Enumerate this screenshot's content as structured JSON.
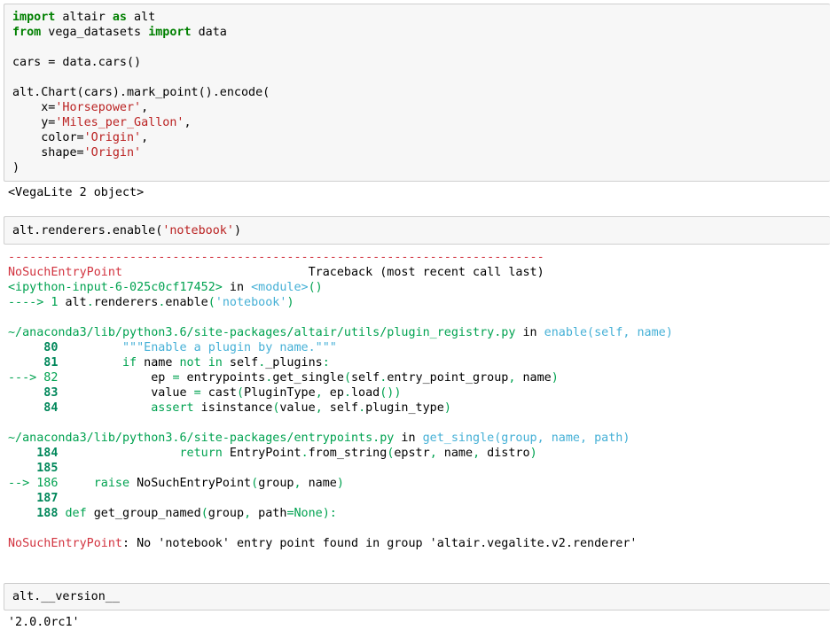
{
  "cell1": {
    "lines": [
      {
        "parts": [
          {
            "t": "import",
            "c": "kw"
          },
          {
            "t": " altair "
          },
          {
            "t": "as",
            "c": "kw"
          },
          {
            "t": " alt"
          }
        ]
      },
      {
        "parts": [
          {
            "t": "from",
            "c": "kw"
          },
          {
            "t": " vega_datasets "
          },
          {
            "t": "import",
            "c": "kw"
          },
          {
            "t": " data"
          }
        ]
      },
      {
        "parts": [
          {
            "t": ""
          }
        ]
      },
      {
        "parts": [
          {
            "t": "cars = data.cars()"
          }
        ]
      },
      {
        "parts": [
          {
            "t": ""
          }
        ]
      },
      {
        "parts": [
          {
            "t": "alt.Chart(cars).mark_point().encode("
          }
        ]
      },
      {
        "parts": [
          {
            "t": "    x="
          },
          {
            "t": "'Horsepower'",
            "c": "str"
          },
          {
            "t": ","
          }
        ]
      },
      {
        "parts": [
          {
            "t": "    y="
          },
          {
            "t": "'Miles_per_Gallon'",
            "c": "str"
          },
          {
            "t": ","
          }
        ]
      },
      {
        "parts": [
          {
            "t": "    color="
          },
          {
            "t": "'Origin'",
            "c": "str"
          },
          {
            "t": ","
          }
        ]
      },
      {
        "parts": [
          {
            "t": "    shape="
          },
          {
            "t": "'Origin'",
            "c": "str"
          }
        ]
      },
      {
        "parts": [
          {
            "t": ")"
          }
        ]
      }
    ]
  },
  "output1": {
    "text": "<VegaLite 2 object>"
  },
  "cell2": {
    "lines": [
      {
        "parts": [
          {
            "t": "alt.renderers.enable("
          },
          {
            "t": "'notebook'",
            "c": "str"
          },
          {
            "t": ")"
          }
        ]
      }
    ]
  },
  "traceback": {
    "lines": [
      {
        "parts": [
          {
            "t": "---------------------------------------------------------------------------",
            "c": "dashes"
          }
        ]
      },
      {
        "parts": [
          {
            "t": "NoSuchEntryPoint",
            "c": "red"
          },
          {
            "t": "                          Traceback (most recent call last)"
          }
        ]
      },
      {
        "parts": [
          {
            "t": "<ipython-input-6-025c0cf17452>",
            "c": "green"
          },
          {
            "t": " in "
          },
          {
            "t": "<module>",
            "c": "cyan"
          },
          {
            "t": "()",
            "c": "green"
          }
        ]
      },
      {
        "parts": [
          {
            "t": "---->",
            "c": "green"
          },
          {
            "t": " 1",
            "c": "green"
          },
          {
            "t": " alt"
          },
          {
            "t": ".",
            "c": "green"
          },
          {
            "t": "renderers"
          },
          {
            "t": ".",
            "c": "green"
          },
          {
            "t": "enable"
          },
          {
            "t": "(",
            "c": "green"
          },
          {
            "t": "'notebook'",
            "c": "cyan"
          },
          {
            "t": ")",
            "c": "green"
          }
        ]
      },
      {
        "parts": [
          {
            "t": ""
          }
        ]
      },
      {
        "parts": [
          {
            "t": "~/anaconda3/lib/python3.6/site-packages/altair/utils/plugin_registry.py",
            "c": "green"
          },
          {
            "t": " in "
          },
          {
            "t": "enable",
            "c": "cyan"
          },
          {
            "t": "(self, name)",
            "c": "cyan"
          }
        ]
      },
      {
        "parts": [
          {
            "t": "     80",
            "c": "ln"
          },
          {
            "t": "         "
          },
          {
            "t": "\"\"\"Enable a plugin by name.\"\"\"",
            "c": "cyan"
          }
        ]
      },
      {
        "parts": [
          {
            "t": "     81",
            "c": "ln"
          },
          {
            "t": "         "
          },
          {
            "t": "if",
            "c": "green"
          },
          {
            "t": " name "
          },
          {
            "t": "not",
            "c": "green"
          },
          {
            "t": " "
          },
          {
            "t": "in",
            "c": "green"
          },
          {
            "t": " self"
          },
          {
            "t": ".",
            "c": "green"
          },
          {
            "t": "_plugins"
          },
          {
            "t": ":",
            "c": "green"
          }
        ]
      },
      {
        "parts": [
          {
            "t": "---> 82",
            "c": "ln-arrow"
          },
          {
            "t": "             ep "
          },
          {
            "t": "=",
            "c": "green"
          },
          {
            "t": " entrypoints"
          },
          {
            "t": ".",
            "c": "green"
          },
          {
            "t": "get_single"
          },
          {
            "t": "(",
            "c": "green"
          },
          {
            "t": "self"
          },
          {
            "t": ".",
            "c": "green"
          },
          {
            "t": "entry_point_group"
          },
          {
            "t": ",",
            "c": "green"
          },
          {
            "t": " name"
          },
          {
            "t": ")",
            "c": "green"
          }
        ]
      },
      {
        "parts": [
          {
            "t": "     83",
            "c": "ln"
          },
          {
            "t": "             value "
          },
          {
            "t": "=",
            "c": "green"
          },
          {
            "t": " cast"
          },
          {
            "t": "(",
            "c": "green"
          },
          {
            "t": "PluginType"
          },
          {
            "t": ",",
            "c": "green"
          },
          {
            "t": " ep"
          },
          {
            "t": ".",
            "c": "green"
          },
          {
            "t": "load"
          },
          {
            "t": "())",
            "c": "green"
          }
        ]
      },
      {
        "parts": [
          {
            "t": "     84",
            "c": "ln"
          },
          {
            "t": "             "
          },
          {
            "t": "assert",
            "c": "green"
          },
          {
            "t": " isinstance"
          },
          {
            "t": "(",
            "c": "green"
          },
          {
            "t": "value"
          },
          {
            "t": ",",
            "c": "green"
          },
          {
            "t": " self"
          },
          {
            "t": ".",
            "c": "green"
          },
          {
            "t": "plugin_type"
          },
          {
            "t": ")",
            "c": "green"
          }
        ]
      },
      {
        "parts": [
          {
            "t": ""
          }
        ]
      },
      {
        "parts": [
          {
            "t": "~/anaconda3/lib/python3.6/site-packages/entrypoints.py",
            "c": "green"
          },
          {
            "t": " in "
          },
          {
            "t": "get_single",
            "c": "cyan"
          },
          {
            "t": "(group, name, path)",
            "c": "cyan"
          }
        ]
      },
      {
        "parts": [
          {
            "t": "    184",
            "c": "ln"
          },
          {
            "t": "                 "
          },
          {
            "t": "return",
            "c": "green"
          },
          {
            "t": " EntryPoint"
          },
          {
            "t": ".",
            "c": "green"
          },
          {
            "t": "from_string"
          },
          {
            "t": "(",
            "c": "green"
          },
          {
            "t": "epstr"
          },
          {
            "t": ",",
            "c": "green"
          },
          {
            "t": " name"
          },
          {
            "t": ",",
            "c": "green"
          },
          {
            "t": " distro"
          },
          {
            "t": ")",
            "c": "green"
          }
        ]
      },
      {
        "parts": [
          {
            "t": "    185",
            "c": "ln"
          }
        ]
      },
      {
        "parts": [
          {
            "t": "--> 186",
            "c": "ln-arrow"
          },
          {
            "t": "     "
          },
          {
            "t": "raise",
            "c": "green"
          },
          {
            "t": " NoSuchEntryPoint"
          },
          {
            "t": "(",
            "c": "green"
          },
          {
            "t": "group"
          },
          {
            "t": ",",
            "c": "green"
          },
          {
            "t": " name"
          },
          {
            "t": ")",
            "c": "green"
          }
        ]
      },
      {
        "parts": [
          {
            "t": "    187",
            "c": "ln"
          }
        ]
      },
      {
        "parts": [
          {
            "t": "    188",
            "c": "ln"
          },
          {
            "t": " "
          },
          {
            "t": "def",
            "c": "green"
          },
          {
            "t": " get_group_named"
          },
          {
            "t": "(",
            "c": "green"
          },
          {
            "t": "group"
          },
          {
            "t": ",",
            "c": "green"
          },
          {
            "t": " path"
          },
          {
            "t": "=None):",
            "c": "green"
          }
        ]
      },
      {
        "parts": [
          {
            "t": ""
          }
        ]
      },
      {
        "parts": [
          {
            "t": "NoSuchEntryPoint",
            "c": "red"
          },
          {
            "t": ": No 'notebook' entry point found in group 'altair.vegalite.v2.renderer'"
          }
        ]
      }
    ]
  },
  "cell3": {
    "lines": [
      {
        "parts": [
          {
            "t": "alt.__version__"
          }
        ]
      }
    ]
  },
  "output3": {
    "text": "'2.0.0rc1'"
  }
}
